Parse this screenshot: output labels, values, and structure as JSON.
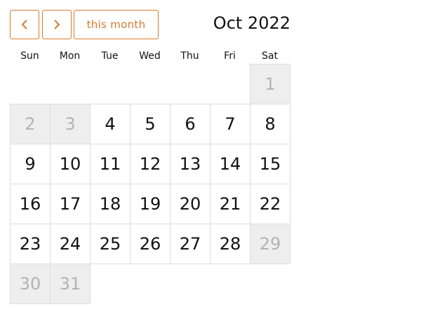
{
  "toolbar": {
    "prev_icon": "chevron-left-icon",
    "next_icon": "chevron-right-icon",
    "today_label": "this month",
    "title": "Oct 2022"
  },
  "colors": {
    "accent": "#d77a2c",
    "outside_bg": "#eeeeee",
    "outside_text": "#b3b3b3",
    "border": "#dddddd"
  },
  "weekdays": [
    "Sun",
    "Mon",
    "Tue",
    "Wed",
    "Thu",
    "Fri",
    "Sat"
  ],
  "weeks": [
    [
      null,
      null,
      null,
      null,
      null,
      null,
      {
        "day": "1",
        "outside": true
      }
    ],
    [
      {
        "day": "2",
        "outside": true
      },
      {
        "day": "3",
        "outside": true
      },
      {
        "day": "4",
        "outside": false
      },
      {
        "day": "5",
        "outside": false
      },
      {
        "day": "6",
        "outside": false
      },
      {
        "day": "7",
        "outside": false
      },
      {
        "day": "8",
        "outside": false
      }
    ],
    [
      {
        "day": "9",
        "outside": false
      },
      {
        "day": "10",
        "outside": false
      },
      {
        "day": "11",
        "outside": false
      },
      {
        "day": "12",
        "outside": false
      },
      {
        "day": "13",
        "outside": false
      },
      {
        "day": "14",
        "outside": false
      },
      {
        "day": "15",
        "outside": false
      }
    ],
    [
      {
        "day": "16",
        "outside": false
      },
      {
        "day": "17",
        "outside": false
      },
      {
        "day": "18",
        "outside": false
      },
      {
        "day": "19",
        "outside": false
      },
      {
        "day": "20",
        "outside": false
      },
      {
        "day": "21",
        "outside": false
      },
      {
        "day": "22",
        "outside": false
      }
    ],
    [
      {
        "day": "23",
        "outside": false
      },
      {
        "day": "24",
        "outside": false
      },
      {
        "day": "25",
        "outside": false
      },
      {
        "day": "26",
        "outside": false
      },
      {
        "day": "27",
        "outside": false
      },
      {
        "day": "28",
        "outside": false
      },
      {
        "day": "29",
        "outside": true
      }
    ],
    [
      {
        "day": "30",
        "outside": true
      },
      {
        "day": "31",
        "outside": true
      },
      null,
      null,
      null,
      null,
      null
    ]
  ]
}
